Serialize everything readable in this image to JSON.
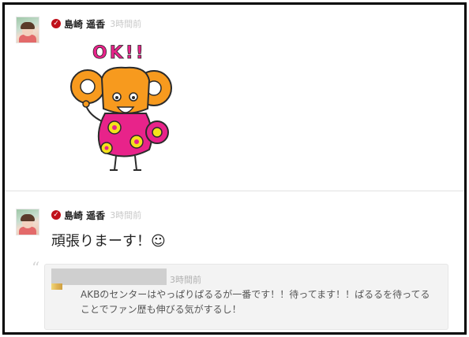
{
  "posts": [
    {
      "author": "島崎 遥香",
      "time": "3時間前",
      "verified_icon": "check-circle-icon",
      "sticker": {
        "text": "OK!!",
        "icon": "mouse-character-sticker",
        "colors": {
          "orange": "#f79a1e",
          "pink": "#e8238a",
          "yellow": "#f4e21a",
          "outline": "#2b2b2b"
        }
      }
    },
    {
      "author": "島崎 遥香",
      "time": "3時間前",
      "verified_icon": "check-circle-icon",
      "message": "頑張りまーす！☺",
      "comment": {
        "time": "3時間前",
        "text": "AKBのセンターはやっぱりぱるるが一番です！！待ってます！！ぱるるを待ってることでファン歴も伸びる気がするし！",
        "quote_icon": "quote-icon"
      }
    }
  ],
  "theme": {
    "verified_color": "#c0101a",
    "time_color": "#c8c8c8",
    "card_bg": "#f3f3f3"
  }
}
